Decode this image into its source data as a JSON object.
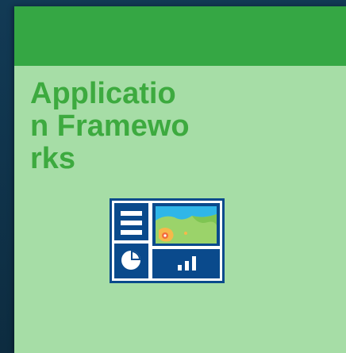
{
  "card": {
    "title": "Application Frameworks",
    "icon": "dashboard-icon",
    "colors": {
      "header": "#35a744",
      "body": "#a6dda6",
      "title": "#3daa3f",
      "icon_frame": "#0a4a8c"
    }
  }
}
